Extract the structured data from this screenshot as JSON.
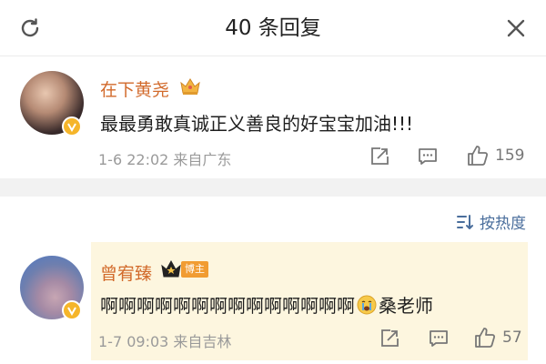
{
  "header": {
    "title": "40 条回复"
  },
  "comments": [
    {
      "username": "在下黄尧",
      "content": "最最勇敢真诚正义善良的好宝宝加油!!!",
      "meta": "1-6 22:02  来自广东",
      "likes": "159"
    },
    {
      "username": "曾宥臻",
      "badge": "博主",
      "content_main": "啊啊啊啊啊啊啊啊啊啊啊啊啊啊",
      "content_tail": "桑老师",
      "meta": "1-7 09:03  来自吉林",
      "likes": "57"
    }
  ],
  "sort": {
    "label": "按热度"
  },
  "colors": {
    "username": "#d26a2b",
    "link": "#4a6e9c",
    "highlight": "#fdf6df",
    "badge": "#f19c32"
  },
  "icons": [
    "refresh-icon",
    "close-icon",
    "crown-icon",
    "verified-icon",
    "share-icon",
    "comment-icon",
    "like-icon",
    "sort-icon",
    "crying-emoji-icon"
  ]
}
